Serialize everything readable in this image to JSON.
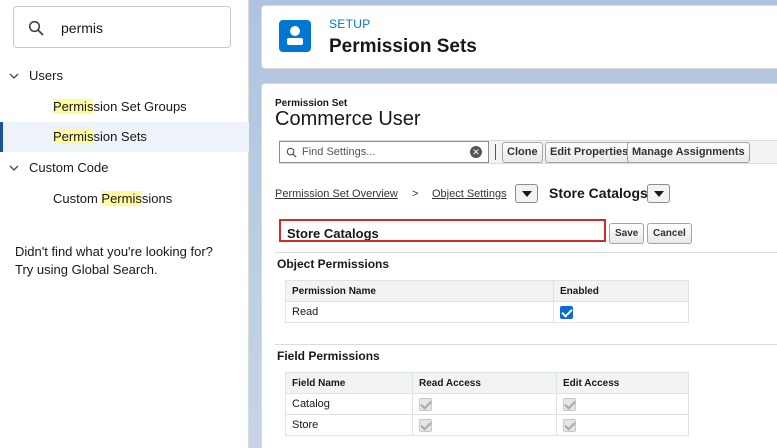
{
  "sidebar": {
    "search_value": "permis",
    "tree": [
      {
        "label_pre": "",
        "label_hl": "",
        "label_post": "Users",
        "expanded": true,
        "level": 0
      },
      {
        "label_pre": "",
        "label_hl": "Permis",
        "label_post": "sion Set Groups",
        "level": 1
      },
      {
        "label_pre": "",
        "label_hl": "Permis",
        "label_post": "sion Sets",
        "level": 1,
        "selected": true
      },
      {
        "label_pre": "",
        "label_hl": "",
        "label_post": "Custom Code",
        "expanded": true,
        "level": 0
      },
      {
        "label_pre": "Custom ",
        "label_hl": "Permis",
        "label_post": "sions",
        "level": 1
      }
    ],
    "not_found_line1": "Didn't find what you're looking for?",
    "not_found_line2": "Try using Global Search."
  },
  "header": {
    "setup_label": "SETUP",
    "title": "Permission Sets"
  },
  "permission_set": {
    "type_label": "Permission Set",
    "name": "Commerce User"
  },
  "toolbar": {
    "find_placeholder": "Find Settings...",
    "buttons": [
      "Clone",
      "Edit Properties",
      "Manage Assignments"
    ]
  },
  "breadcrumb": {
    "overview": "Permission Set Overview",
    "separator": ">",
    "object_settings": "Object Settings",
    "current": "Store Catalogs"
  },
  "section": {
    "title": "Store Catalogs",
    "save": "Save",
    "cancel": "Cancel"
  },
  "object_permissions": {
    "heading": "Object Permissions",
    "columns": [
      "Permission Name",
      "Enabled"
    ],
    "rows": [
      {
        "name": "Read",
        "enabled": true
      }
    ]
  },
  "field_permissions": {
    "heading": "Field Permissions",
    "columns": [
      "Field Name",
      "Read Access",
      "Edit Access"
    ],
    "rows": [
      {
        "name": "Catalog",
        "read": true,
        "edit": true
      },
      {
        "name": "Store",
        "read": true,
        "edit": true
      }
    ]
  },
  "colors": {
    "accent": "#0176d3",
    "highlight": "#fefa9d",
    "callout": "#d62a2a"
  }
}
